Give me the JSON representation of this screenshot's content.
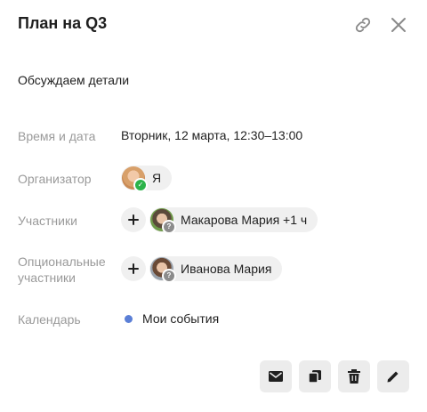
{
  "header": {
    "title": "План на Q3",
    "link_icon": "link-icon",
    "close_icon": "close-icon"
  },
  "description": "Обсуждаем детали",
  "details": {
    "time": {
      "label": "Время и дата",
      "value": "Вторник, 12 марта, 12:30–13:00"
    },
    "organizer": {
      "label": "Организатор",
      "name": "Я",
      "status": "accepted"
    },
    "participants": {
      "label": "Участники",
      "name": "Макарова Мария +1 ч",
      "status": "unknown"
    },
    "optional": {
      "label_line1": "Опциональные",
      "label_line2": "участники",
      "name": "Иванова Мария",
      "status": "unknown"
    },
    "calendar": {
      "label": "Календарь",
      "name": "Мои события",
      "color": "#5b7fd6"
    }
  },
  "actions": [
    {
      "icon": "mail-icon"
    },
    {
      "icon": "copy-icon"
    },
    {
      "icon": "trash-icon"
    },
    {
      "icon": "edit-icon"
    }
  ],
  "colors": {
    "label": "#9a9a9a",
    "chip_bg": "#f0f0f0",
    "accepted": "#2cb34a",
    "unknown": "#8c8c8c"
  }
}
